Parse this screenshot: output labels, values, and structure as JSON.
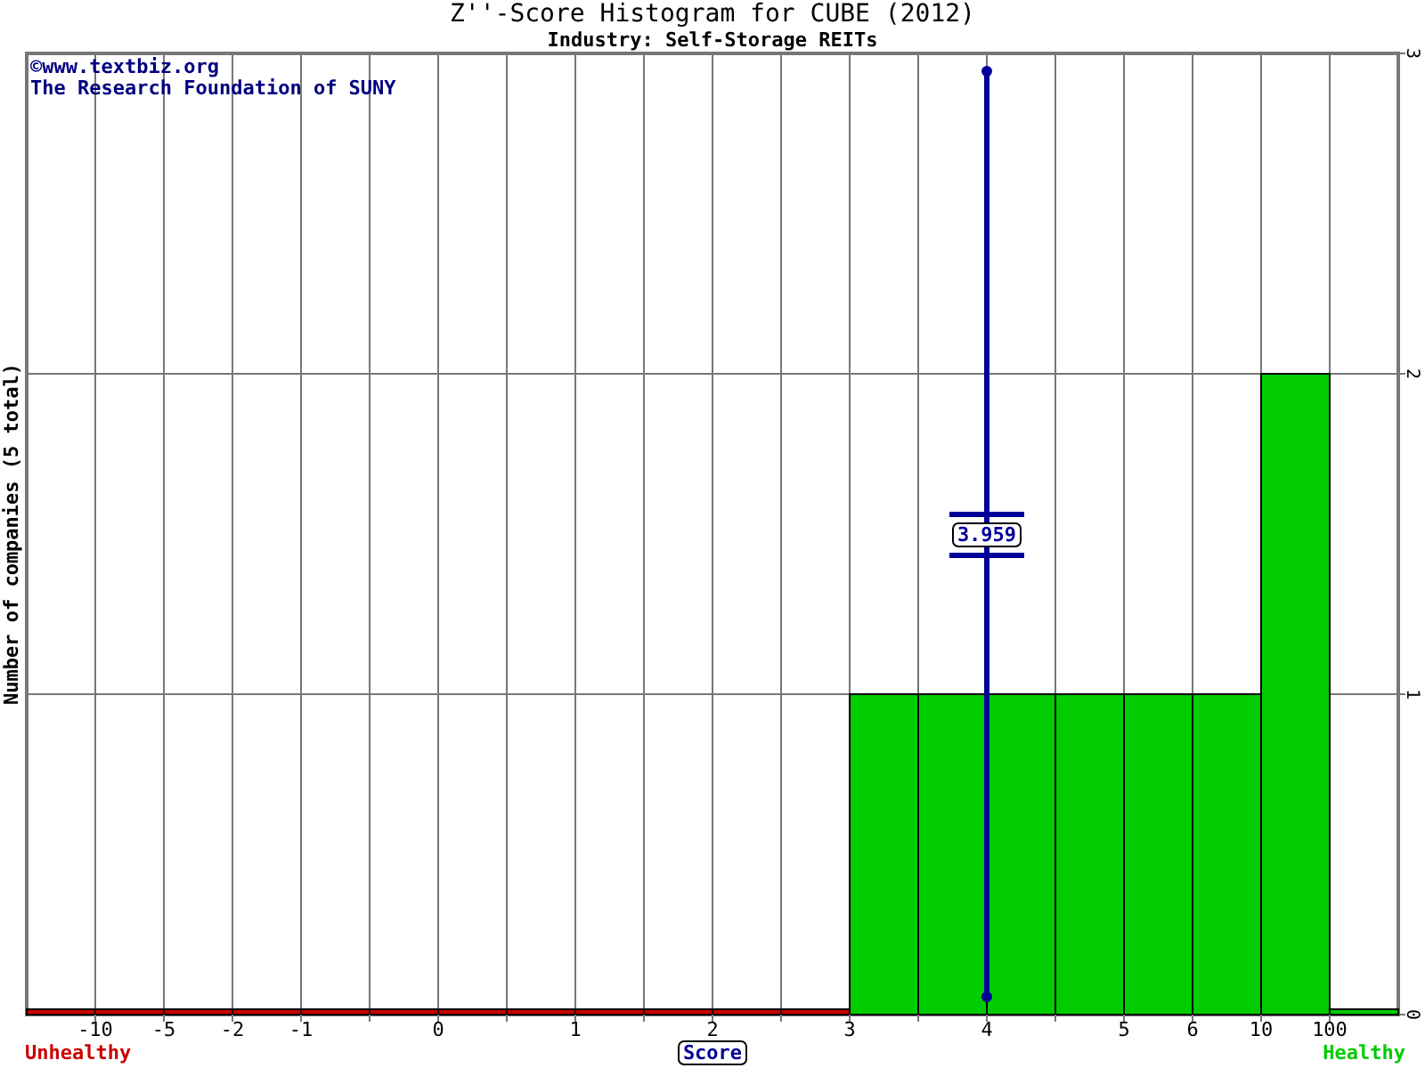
{
  "title": "Z''-Score Histogram for CUBE (2012)",
  "subtitle": "Industry: Self-Storage REITs",
  "credits": [
    "©www.textbiz.org",
    "The Research Foundation of SUNY"
  ],
  "zone_labels": {
    "left": "Unhealthy",
    "right": "Healthy"
  },
  "chart_data": {
    "type": "bar",
    "xlabel": "Score",
    "ylabel": "Number of companies (5 total)",
    "ylim": [
      0,
      3
    ],
    "grid": true,
    "categories": [
      null,
      "-10",
      "-5",
      "-2",
      "-1",
      null,
      "0",
      null,
      "1",
      null,
      "2",
      null,
      "3",
      null,
      "4",
      null,
      "5",
      "6",
      "10",
      "100"
    ],
    "series": [
      {
        "color": "#cc0000",
        "values": [
          0,
          0,
          0,
          0,
          0,
          0,
          0,
          0,
          0,
          0,
          0,
          0,
          null,
          null,
          null,
          null,
          null,
          null,
          null,
          null
        ]
      },
      {
        "color": "#00cc00",
        "values": [
          null,
          null,
          null,
          null,
          null,
          null,
          null,
          null,
          null,
          null,
          null,
          null,
          1,
          1,
          1,
          1,
          1,
          1,
          2,
          0
        ]
      }
    ],
    "yticks": [
      0,
      1,
      2,
      3
    ],
    "ref_lines": [
      {
        "axis": "x",
        "value": "4",
        "color": "#000099"
      }
    ],
    "annotations": [
      {
        "x": "4",
        "y": 1.5,
        "text": "3.959"
      }
    ]
  }
}
